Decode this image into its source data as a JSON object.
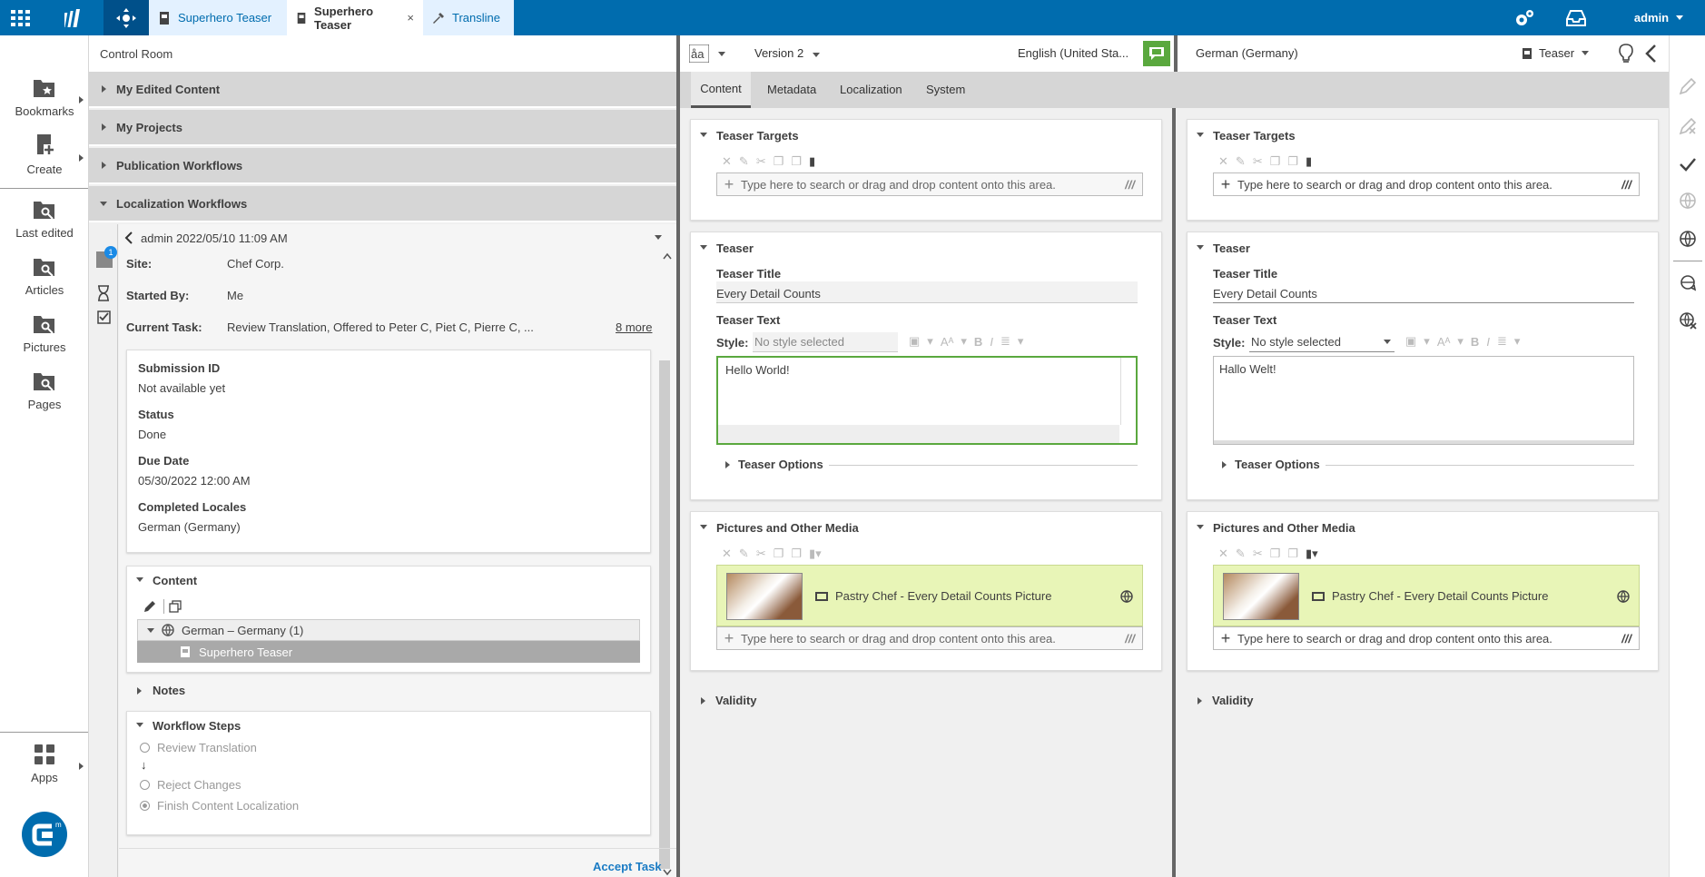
{
  "topbar": {
    "tabs": [
      {
        "label": "Superhero Teaser",
        "closable": false,
        "active": false
      },
      {
        "label": "Superhero Teaser",
        "closable": true,
        "active": true,
        "close": "×"
      },
      {
        "label": "Transline",
        "closable": false,
        "active": false
      }
    ],
    "user": "admin",
    "accent": "#006cae"
  },
  "leftnav": {
    "items": [
      {
        "label": "Bookmarks",
        "icon": "bookmark-folder-icon"
      },
      {
        "label": "Create",
        "icon": "create-document-icon"
      },
      {
        "label": "Last edited",
        "icon": "search-folder-icon"
      },
      {
        "label": "Articles",
        "icon": "search-folder-icon"
      },
      {
        "label": "Pictures",
        "icon": "search-folder-icon"
      },
      {
        "label": "Pages",
        "icon": "search-folder-icon"
      },
      {
        "label": "Apps",
        "icon": "apps-grid-icon"
      }
    ]
  },
  "control_room": {
    "title": "Control Room",
    "sections": [
      "My Edited Content",
      "My Projects",
      "Publication Workflows",
      "Localization Workflows"
    ],
    "workflow": {
      "header": "admin 2022/05/10 11:09 AM",
      "badge": "1",
      "site_label": "Site:",
      "site": "Chef Corp.",
      "started_label": "Started By:",
      "started": "Me",
      "task_label": "Current Task:",
      "task": "Review Translation, Offered to Peter C, Piet C, Pierre C, ...",
      "more": "8 more",
      "details": [
        {
          "label": "Submission ID",
          "value": "Not available yet"
        },
        {
          "label": "Status",
          "value": "Done"
        },
        {
          "label": "Due Date",
          "value": "05/30/2022 12:00 AM"
        },
        {
          "label": "Completed Locales",
          "value": "German (Germany)"
        }
      ],
      "content_title": "Content",
      "tree_group": "German – Germany (1)",
      "tree_item": "Superhero Teaser",
      "notes": "Notes",
      "steps_title": "Workflow Steps",
      "steps": [
        "Review Translation",
        "Reject Changes",
        "Finish Content Localization"
      ],
      "arrow": "↓",
      "accept": "Accept Task"
    }
  },
  "editor": {
    "version": "Version 2",
    "locale_left": "English (United Sta...",
    "locale_right": "German (Germany)",
    "doctype": "Teaser",
    "tabs": [
      "Content",
      "Metadata",
      "Localization",
      "System"
    ],
    "drop_placeholder": "Type here to search or drag and drop content onto this area.",
    "teaser_targets": "Teaser Targets",
    "teaser": "Teaser",
    "teaser_title_label": "Teaser Title",
    "teaser_title": "Every Detail Counts",
    "teaser_text_label": "Teaser Text",
    "style_label": "Style:",
    "style_value": "No style selected",
    "text_left": "Hello World!",
    "text_right": "Hallo Welt!",
    "teaser_options": "Teaser Options",
    "media": "Pictures and Other Media",
    "picture": "Pastry Chef - Every Detail Counts Picture",
    "validity": "Validity",
    "highlight": "#e8f5b7",
    "focus_green": "#5aa83e"
  }
}
